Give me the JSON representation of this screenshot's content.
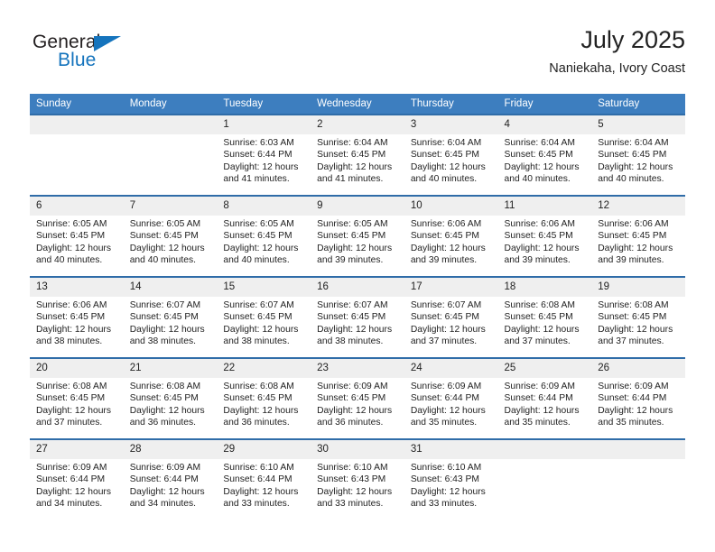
{
  "brand": {
    "name_part1": "General",
    "name_part2": "Blue",
    "triangle_color": "#1574bd",
    "text_color": "#231f20"
  },
  "header": {
    "title": "July 2025",
    "subtitle": "Naniekaha, Ivory Coast"
  },
  "theme": {
    "header_bg": "#3d7ebf",
    "row_border": "#2f6ca8",
    "daynum_bg": "#efefef",
    "page_bg": "#ffffff"
  },
  "calendar": {
    "weekday_headers": [
      "Sunday",
      "Monday",
      "Tuesday",
      "Wednesday",
      "Thursday",
      "Friday",
      "Saturday"
    ],
    "weeks": [
      [
        {
          "day": "",
          "sunrise": "",
          "sunset": "",
          "daylight1": "",
          "daylight2": ""
        },
        {
          "day": "",
          "sunrise": "",
          "sunset": "",
          "daylight1": "",
          "daylight2": ""
        },
        {
          "day": "1",
          "sunrise": "Sunrise: 6:03 AM",
          "sunset": "Sunset: 6:44 PM",
          "daylight1": "Daylight: 12 hours",
          "daylight2": "and 41 minutes."
        },
        {
          "day": "2",
          "sunrise": "Sunrise: 6:04 AM",
          "sunset": "Sunset: 6:45 PM",
          "daylight1": "Daylight: 12 hours",
          "daylight2": "and 41 minutes."
        },
        {
          "day": "3",
          "sunrise": "Sunrise: 6:04 AM",
          "sunset": "Sunset: 6:45 PM",
          "daylight1": "Daylight: 12 hours",
          "daylight2": "and 40 minutes."
        },
        {
          "day": "4",
          "sunrise": "Sunrise: 6:04 AM",
          "sunset": "Sunset: 6:45 PM",
          "daylight1": "Daylight: 12 hours",
          "daylight2": "and 40 minutes."
        },
        {
          "day": "5",
          "sunrise": "Sunrise: 6:04 AM",
          "sunset": "Sunset: 6:45 PM",
          "daylight1": "Daylight: 12 hours",
          "daylight2": "and 40 minutes."
        }
      ],
      [
        {
          "day": "6",
          "sunrise": "Sunrise: 6:05 AM",
          "sunset": "Sunset: 6:45 PM",
          "daylight1": "Daylight: 12 hours",
          "daylight2": "and 40 minutes."
        },
        {
          "day": "7",
          "sunrise": "Sunrise: 6:05 AM",
          "sunset": "Sunset: 6:45 PM",
          "daylight1": "Daylight: 12 hours",
          "daylight2": "and 40 minutes."
        },
        {
          "day": "8",
          "sunrise": "Sunrise: 6:05 AM",
          "sunset": "Sunset: 6:45 PM",
          "daylight1": "Daylight: 12 hours",
          "daylight2": "and 40 minutes."
        },
        {
          "day": "9",
          "sunrise": "Sunrise: 6:05 AM",
          "sunset": "Sunset: 6:45 PM",
          "daylight1": "Daylight: 12 hours",
          "daylight2": "and 39 minutes."
        },
        {
          "day": "10",
          "sunrise": "Sunrise: 6:06 AM",
          "sunset": "Sunset: 6:45 PM",
          "daylight1": "Daylight: 12 hours",
          "daylight2": "and 39 minutes."
        },
        {
          "day": "11",
          "sunrise": "Sunrise: 6:06 AM",
          "sunset": "Sunset: 6:45 PM",
          "daylight1": "Daylight: 12 hours",
          "daylight2": "and 39 minutes."
        },
        {
          "day": "12",
          "sunrise": "Sunrise: 6:06 AM",
          "sunset": "Sunset: 6:45 PM",
          "daylight1": "Daylight: 12 hours",
          "daylight2": "and 39 minutes."
        }
      ],
      [
        {
          "day": "13",
          "sunrise": "Sunrise: 6:06 AM",
          "sunset": "Sunset: 6:45 PM",
          "daylight1": "Daylight: 12 hours",
          "daylight2": "and 38 minutes."
        },
        {
          "day": "14",
          "sunrise": "Sunrise: 6:07 AM",
          "sunset": "Sunset: 6:45 PM",
          "daylight1": "Daylight: 12 hours",
          "daylight2": "and 38 minutes."
        },
        {
          "day": "15",
          "sunrise": "Sunrise: 6:07 AM",
          "sunset": "Sunset: 6:45 PM",
          "daylight1": "Daylight: 12 hours",
          "daylight2": "and 38 minutes."
        },
        {
          "day": "16",
          "sunrise": "Sunrise: 6:07 AM",
          "sunset": "Sunset: 6:45 PM",
          "daylight1": "Daylight: 12 hours",
          "daylight2": "and 38 minutes."
        },
        {
          "day": "17",
          "sunrise": "Sunrise: 6:07 AM",
          "sunset": "Sunset: 6:45 PM",
          "daylight1": "Daylight: 12 hours",
          "daylight2": "and 37 minutes."
        },
        {
          "day": "18",
          "sunrise": "Sunrise: 6:08 AM",
          "sunset": "Sunset: 6:45 PM",
          "daylight1": "Daylight: 12 hours",
          "daylight2": "and 37 minutes."
        },
        {
          "day": "19",
          "sunrise": "Sunrise: 6:08 AM",
          "sunset": "Sunset: 6:45 PM",
          "daylight1": "Daylight: 12 hours",
          "daylight2": "and 37 minutes."
        }
      ],
      [
        {
          "day": "20",
          "sunrise": "Sunrise: 6:08 AM",
          "sunset": "Sunset: 6:45 PM",
          "daylight1": "Daylight: 12 hours",
          "daylight2": "and 37 minutes."
        },
        {
          "day": "21",
          "sunrise": "Sunrise: 6:08 AM",
          "sunset": "Sunset: 6:45 PM",
          "daylight1": "Daylight: 12 hours",
          "daylight2": "and 36 minutes."
        },
        {
          "day": "22",
          "sunrise": "Sunrise: 6:08 AM",
          "sunset": "Sunset: 6:45 PM",
          "daylight1": "Daylight: 12 hours",
          "daylight2": "and 36 minutes."
        },
        {
          "day": "23",
          "sunrise": "Sunrise: 6:09 AM",
          "sunset": "Sunset: 6:45 PM",
          "daylight1": "Daylight: 12 hours",
          "daylight2": "and 36 minutes."
        },
        {
          "day": "24",
          "sunrise": "Sunrise: 6:09 AM",
          "sunset": "Sunset: 6:44 PM",
          "daylight1": "Daylight: 12 hours",
          "daylight2": "and 35 minutes."
        },
        {
          "day": "25",
          "sunrise": "Sunrise: 6:09 AM",
          "sunset": "Sunset: 6:44 PM",
          "daylight1": "Daylight: 12 hours",
          "daylight2": "and 35 minutes."
        },
        {
          "day": "26",
          "sunrise": "Sunrise: 6:09 AM",
          "sunset": "Sunset: 6:44 PM",
          "daylight1": "Daylight: 12 hours",
          "daylight2": "and 35 minutes."
        }
      ],
      [
        {
          "day": "27",
          "sunrise": "Sunrise: 6:09 AM",
          "sunset": "Sunset: 6:44 PM",
          "daylight1": "Daylight: 12 hours",
          "daylight2": "and 34 minutes."
        },
        {
          "day": "28",
          "sunrise": "Sunrise: 6:09 AM",
          "sunset": "Sunset: 6:44 PM",
          "daylight1": "Daylight: 12 hours",
          "daylight2": "and 34 minutes."
        },
        {
          "day": "29",
          "sunrise": "Sunrise: 6:10 AM",
          "sunset": "Sunset: 6:44 PM",
          "daylight1": "Daylight: 12 hours",
          "daylight2": "and 33 minutes."
        },
        {
          "day": "30",
          "sunrise": "Sunrise: 6:10 AM",
          "sunset": "Sunset: 6:43 PM",
          "daylight1": "Daylight: 12 hours",
          "daylight2": "and 33 minutes."
        },
        {
          "day": "31",
          "sunrise": "Sunrise: 6:10 AM",
          "sunset": "Sunset: 6:43 PM",
          "daylight1": "Daylight: 12 hours",
          "daylight2": "and 33 minutes."
        },
        {
          "day": "",
          "sunrise": "",
          "sunset": "",
          "daylight1": "",
          "daylight2": ""
        },
        {
          "day": "",
          "sunrise": "",
          "sunset": "",
          "daylight1": "",
          "daylight2": ""
        }
      ]
    ]
  }
}
